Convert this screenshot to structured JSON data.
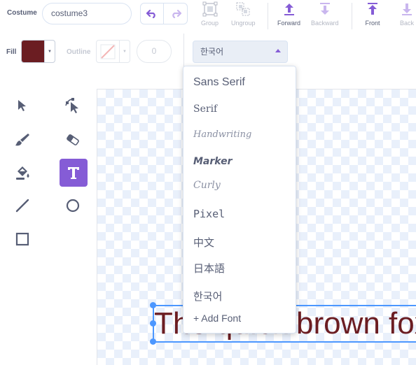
{
  "costume": {
    "label": "Costume",
    "name": "costume3"
  },
  "toolbar": {
    "group": "Group",
    "ungroup": "Ungroup",
    "forward": "Forward",
    "backward": "Backward",
    "front": "Front",
    "back": "Back"
  },
  "fill": {
    "label": "Fill",
    "color": "#6b1d22"
  },
  "outline": {
    "label": "Outline",
    "width": "0"
  },
  "font": {
    "selected": "한국어",
    "options": [
      "Sans Serif",
      "Serif",
      "Handwriting",
      "Marker",
      "Curly",
      "Pixel",
      "中文",
      "日本語",
      "한국어"
    ],
    "add_font": "+ Add Font"
  },
  "canvas": {
    "text": "The quick brown fox"
  },
  "colors": {
    "accent": "#855cd6",
    "selection": "#4c97ff",
    "text_ink": "#6b1d22"
  },
  "icons": [
    "undo-icon",
    "redo-icon",
    "group-icon",
    "ungroup-icon",
    "forward-icon",
    "backward-icon",
    "front-icon",
    "back-icon",
    "select-icon",
    "reshape-icon",
    "brush-icon",
    "eraser-icon",
    "fill-icon",
    "text-icon",
    "line-icon",
    "circle-icon",
    "rectangle-icon"
  ]
}
